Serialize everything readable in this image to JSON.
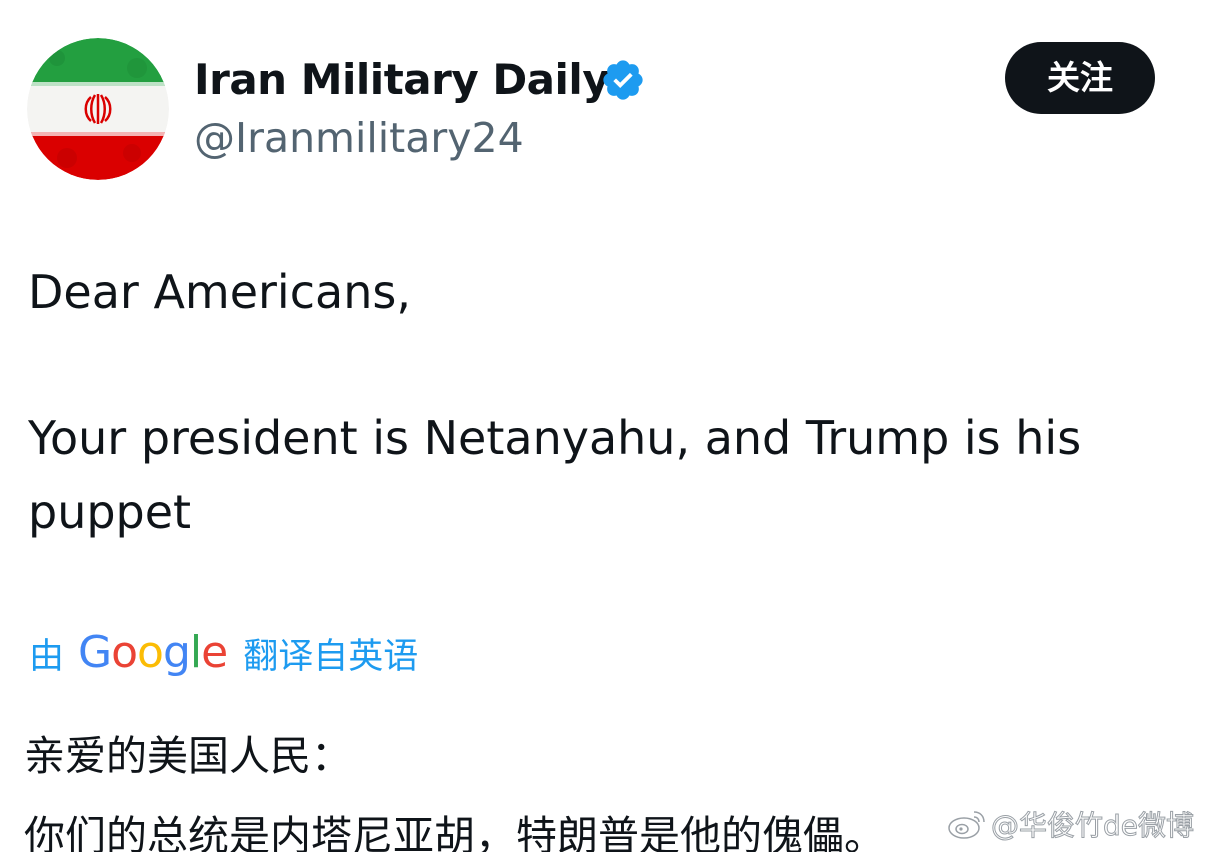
{
  "account": {
    "display_name": "Iran Military Daily",
    "handle": "@Iranmilitary24",
    "avatar_icon": "iran-flag-avatar",
    "verified_icon": "verified-badge-icon",
    "verified_color": "#1d9bf0"
  },
  "follow_button": {
    "label": "关注"
  },
  "tweet": {
    "lines": [
      "Dear Americans,",
      "Your president is Netanyahu, and Trump is his",
      "puppet"
    ]
  },
  "translation": {
    "prefix": "由",
    "provider": "Google",
    "suffix": "翻译自英语",
    "link_color": "#1d9bf0"
  },
  "translated": {
    "lines": [
      "亲爱的美国人民：",
      "你们的总统是内塔尼亚胡，特朗普是他的傀儡。"
    ]
  },
  "watermark": {
    "text": "@华俊竹de微博",
    "icon": "weibo-icon"
  },
  "colors": {
    "text_primary": "#0f1419",
    "text_secondary": "#536471",
    "follow_bg": "#0f1419",
    "flag_green": "#239f40",
    "flag_red": "#da0000"
  }
}
